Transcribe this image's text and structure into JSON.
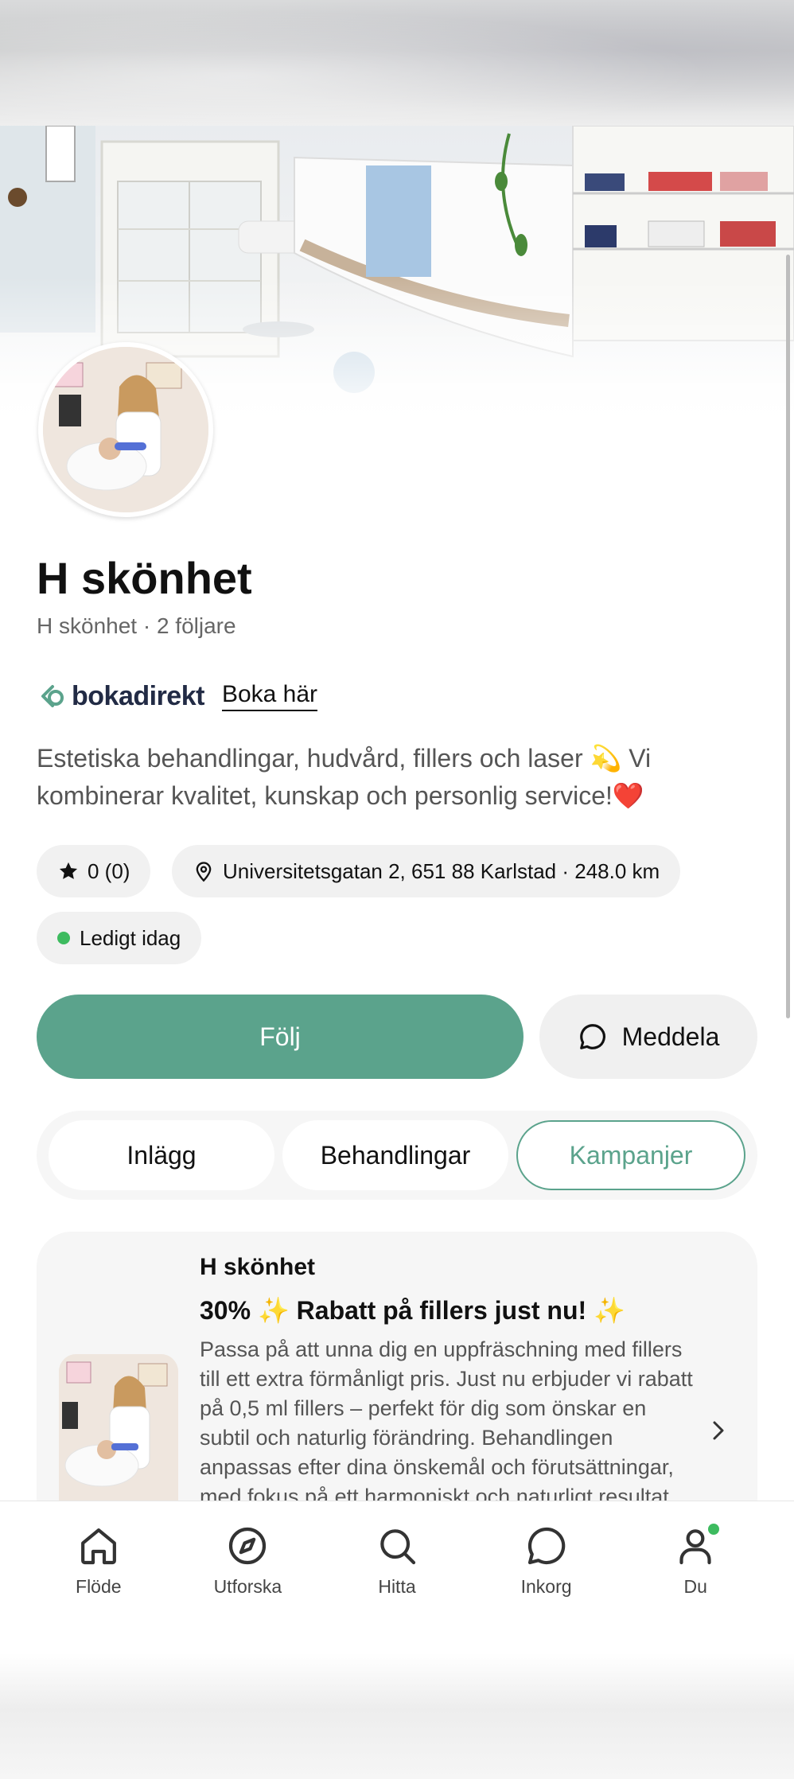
{
  "profile": {
    "name": "H skönhet",
    "subtitle": "H skönhet · 2 följare",
    "brand_name": "bokadirekt",
    "book_link": "Boka här",
    "description": "Estetiska behandlingar, hudvård, fillers och laser 💫 Vi kombinerar kvalitet, kunskap och personlig service!❤️"
  },
  "chips": {
    "rating": "0 (0)",
    "address": "Universitetsgatan 2, 651 88 Karlstad · 248.0 km",
    "availability": "Ledigt idag"
  },
  "actions": {
    "follow": "Följ",
    "message": "Meddela"
  },
  "tabs": [
    {
      "label": "Inlägg",
      "active": false
    },
    {
      "label": "Behandlingar",
      "active": false
    },
    {
      "label": "Kampanjer",
      "active": true
    }
  ],
  "campaign": {
    "author": "H skönhet",
    "title": "30% ✨ Rabatt på fillers just nu! ✨",
    "body": "Passa på att unna dig en uppfräschning med fillers till ett extra förmånligt pris. Just nu erbjuder vi rabatt på 0,5 ml fillers – perfekt för dig som önskar en subtil och naturlig förändring. Behandlingen anpassas efter dina önskemål och förutsättningar, med fokus på ett harmoniskt och naturligt resultat."
  },
  "nav": [
    {
      "label": "Flöde",
      "icon": "home-icon"
    },
    {
      "label": "Utforska",
      "icon": "compass-icon"
    },
    {
      "label": "Hitta",
      "icon": "search-icon"
    },
    {
      "label": "Inkorg",
      "icon": "chat-icon"
    },
    {
      "label": "Du",
      "icon": "user-icon"
    }
  ],
  "colors": {
    "accent": "#5ba38c",
    "status_green": "#3dbb5f"
  }
}
